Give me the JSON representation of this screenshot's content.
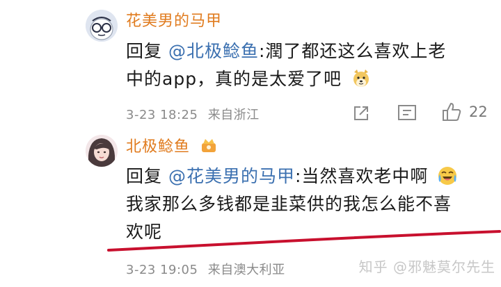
{
  "comments": [
    {
      "username": "花美男的马甲",
      "reply_prefix": "回复 ",
      "mention": "@北极鲶鱼",
      "lines": [
        ":潤了都还这么喜欢上老",
        "中的app，真的是太爱了吧"
      ],
      "emoji": "doge-emoji",
      "date": "3-23 18:25",
      "location": "来自浙江",
      "likes": "22"
    },
    {
      "username": "北极鲶鱼",
      "badge": "crown-badge",
      "reply_prefix": "回复 ",
      "mention": "@花美男的马甲",
      "lines": [
        ":当然喜欢老中啊",
        "我家那么多钱都是韭菜供的我怎么能不喜",
        "欢呢"
      ],
      "emoji": "laugh-cry-emoji",
      "date": "3-23 19:05",
      "location": "来自澳大利亚"
    }
  ],
  "watermark": "知乎 @邪魅莫尔先生",
  "colors": {
    "username": "#e07b1e",
    "mention": "#3b70b0",
    "meta": "#8a8a8a",
    "underline": "#c8102e"
  }
}
